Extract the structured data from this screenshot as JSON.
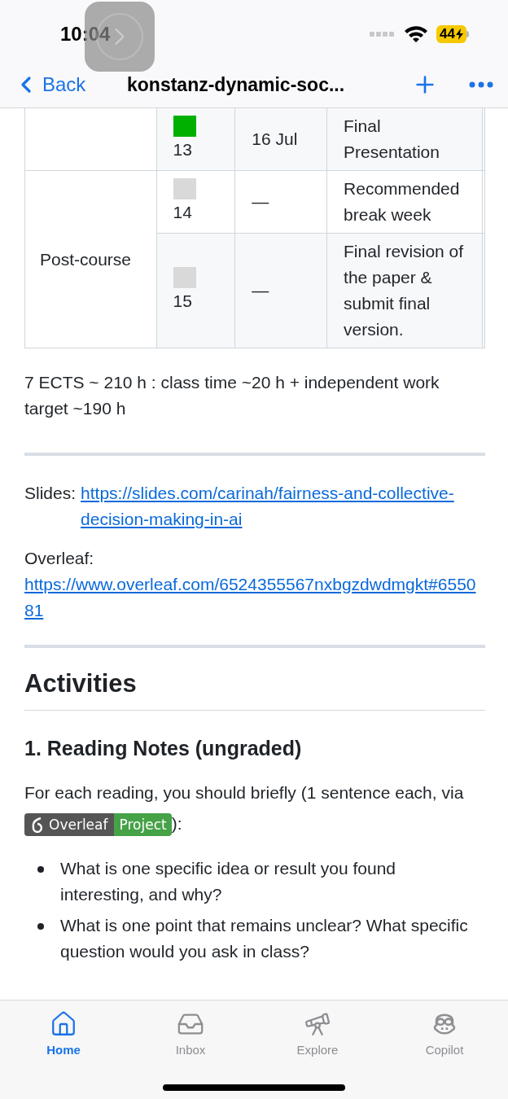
{
  "status_bar": {
    "time": "10:04",
    "battery": "44"
  },
  "nav": {
    "back": "Back",
    "title": "konstanz-dynamic-soc..."
  },
  "schedule": {
    "groups": [
      {
        "rows": [
          {
            "week": "13",
            "color": "#00b000",
            "date": "16 Jul",
            "topic": "Final Presentation"
          }
        ]
      },
      {
        "phase": "Post-course",
        "rows": [
          {
            "week": "14",
            "color": "#d9d9d9",
            "date": "—",
            "topic": "Recommended break week"
          },
          {
            "week": "15",
            "color": "#d9d9d9",
            "date": "—",
            "topic": "Final revision of the paper & submit final version."
          }
        ]
      }
    ]
  },
  "summary": "7 ECTS ~ 210 h : class time ~20 h + independent work target ~190 h",
  "links": [
    {
      "label": "Slides:",
      "url": "https://slides.com/carinah/fairness-and-collective-decision-making-in-ai"
    },
    {
      "label": "Overleaf:",
      "url": "https://www.overleaf.com/6524355567nxbgzdwdmgkt#655081"
    }
  ],
  "heading": "Activities",
  "subheading": "1. Reading Notes (ungraded)",
  "intro": {
    "before": "For each reading, you should briefly (1 sentence each, via",
    "badge": {
      "left": "Overleaf",
      "right": "Project"
    },
    "after": "):"
  },
  "bullets": [
    "What is one specific idea or result you found interesting, and why?",
    "What is one point that remains unclear? What specific question would you ask in class?"
  ],
  "tabs": [
    {
      "label": "Home",
      "selected": true
    },
    {
      "label": "Inbox",
      "selected": false
    },
    {
      "label": "Explore",
      "selected": false
    },
    {
      "label": "Copilot",
      "selected": false
    }
  ]
}
